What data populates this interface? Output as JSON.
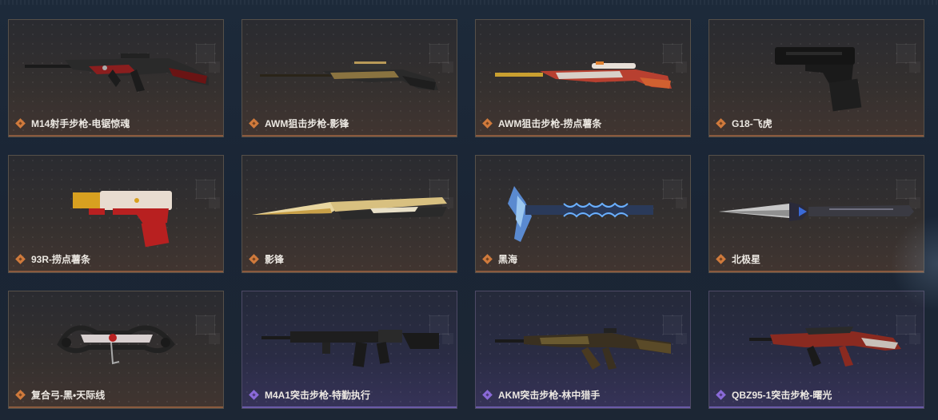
{
  "items": [
    {
      "name": "M14射手步枪-电锯惊魂",
      "rarity": "orange",
      "icon": "rifle-icon"
    },
    {
      "name": "AWM狙击步枪-影锋",
      "rarity": "orange",
      "icon": "sniper-icon"
    },
    {
      "name": "AWM狙击步枪-捞点薯条",
      "rarity": "orange",
      "icon": "sniper-icon"
    },
    {
      "name": "G18-飞虎",
      "rarity": "orange",
      "icon": "pistol-icon"
    },
    {
      "name": "93R-捞点薯条",
      "rarity": "orange",
      "icon": "pistol-icon"
    },
    {
      "name": "影锋",
      "rarity": "orange",
      "icon": "blade-icon"
    },
    {
      "name": "黑海",
      "rarity": "orange",
      "icon": "axe-icon"
    },
    {
      "name": "北极星",
      "rarity": "orange",
      "icon": "knife-icon"
    },
    {
      "name": "复合弓-黑•天际线",
      "rarity": "orange",
      "icon": "bow-icon"
    },
    {
      "name": "M4A1突击步枪-特勤执行",
      "rarity": "purple",
      "icon": "rifle-icon"
    },
    {
      "name": "AKM突击步枪-林中猎手",
      "rarity": "purple",
      "icon": "rifle-icon"
    },
    {
      "name": "QBZ95-1突击步枪-曙光",
      "rarity": "purple",
      "icon": "rifle-icon"
    }
  ],
  "colors": {
    "orange": "#d07a3c",
    "purple": "#8a6ad8"
  }
}
